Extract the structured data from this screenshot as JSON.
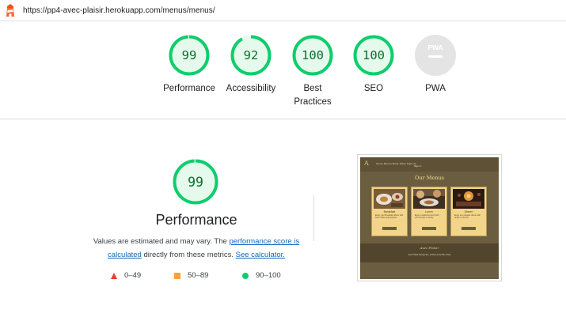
{
  "browser": {
    "url": "https://pp4-avec-plaisir.herokuapp.com/menus/menus/"
  },
  "summary": {
    "gauges": [
      {
        "label": "Performance",
        "value": "99",
        "score": 99
      },
      {
        "label": "Accessibility",
        "value": "92",
        "score": 92
      },
      {
        "label": "Best Practices",
        "value": "100",
        "score": 100
      },
      {
        "label": "SEO",
        "value": "100",
        "score": 100
      }
    ],
    "pwa": {
      "label": "PWA",
      "badge": "PWA"
    }
  },
  "detail": {
    "score": "99",
    "score_value": 99,
    "title": "Performance",
    "description": {
      "prefix": "Values are estimated and may vary. The ",
      "link1": "performance score is calculated",
      "middle": " directly from these metrics. ",
      "link2": "See calculator."
    },
    "legend": [
      {
        "shape": "triangle",
        "range": "0–49",
        "color": "#eb3b2f"
      },
      {
        "shape": "square",
        "range": "50–89",
        "color": "#faa23a"
      },
      {
        "shape": "circle",
        "range": "90–100",
        "color": "#0cce6b"
      }
    ]
  },
  "thumbnail": {
    "logo": "A",
    "nav_links": "Home  Menus  Book Table  Sign Up",
    "nav_links2": "Sign In",
    "heading": "Our Menus",
    "cards": [
      {
        "title": "Breakfast",
        "text": "Enjoy your Breakfast Menu with fresh coffee and pastries."
      },
      {
        "title": "Lunch",
        "text": "Enjoy a delicious lunch with your friends or family."
      },
      {
        "title": "Dinner",
        "text": "Enjoy an exquisite dinner with family or friends."
      }
    ],
    "footer_title": "Avec Plaisir",
    "footer_text": "Avec Plaisir Restaurant, 10 Rue de la Paix, Paris"
  },
  "colors": {
    "pass": "#0cce6b",
    "pass_text": "#0c6e2e",
    "pass_bg": "#e5f9ec",
    "pwa_grey": "#e4e4e4",
    "link": "#1565c0"
  }
}
